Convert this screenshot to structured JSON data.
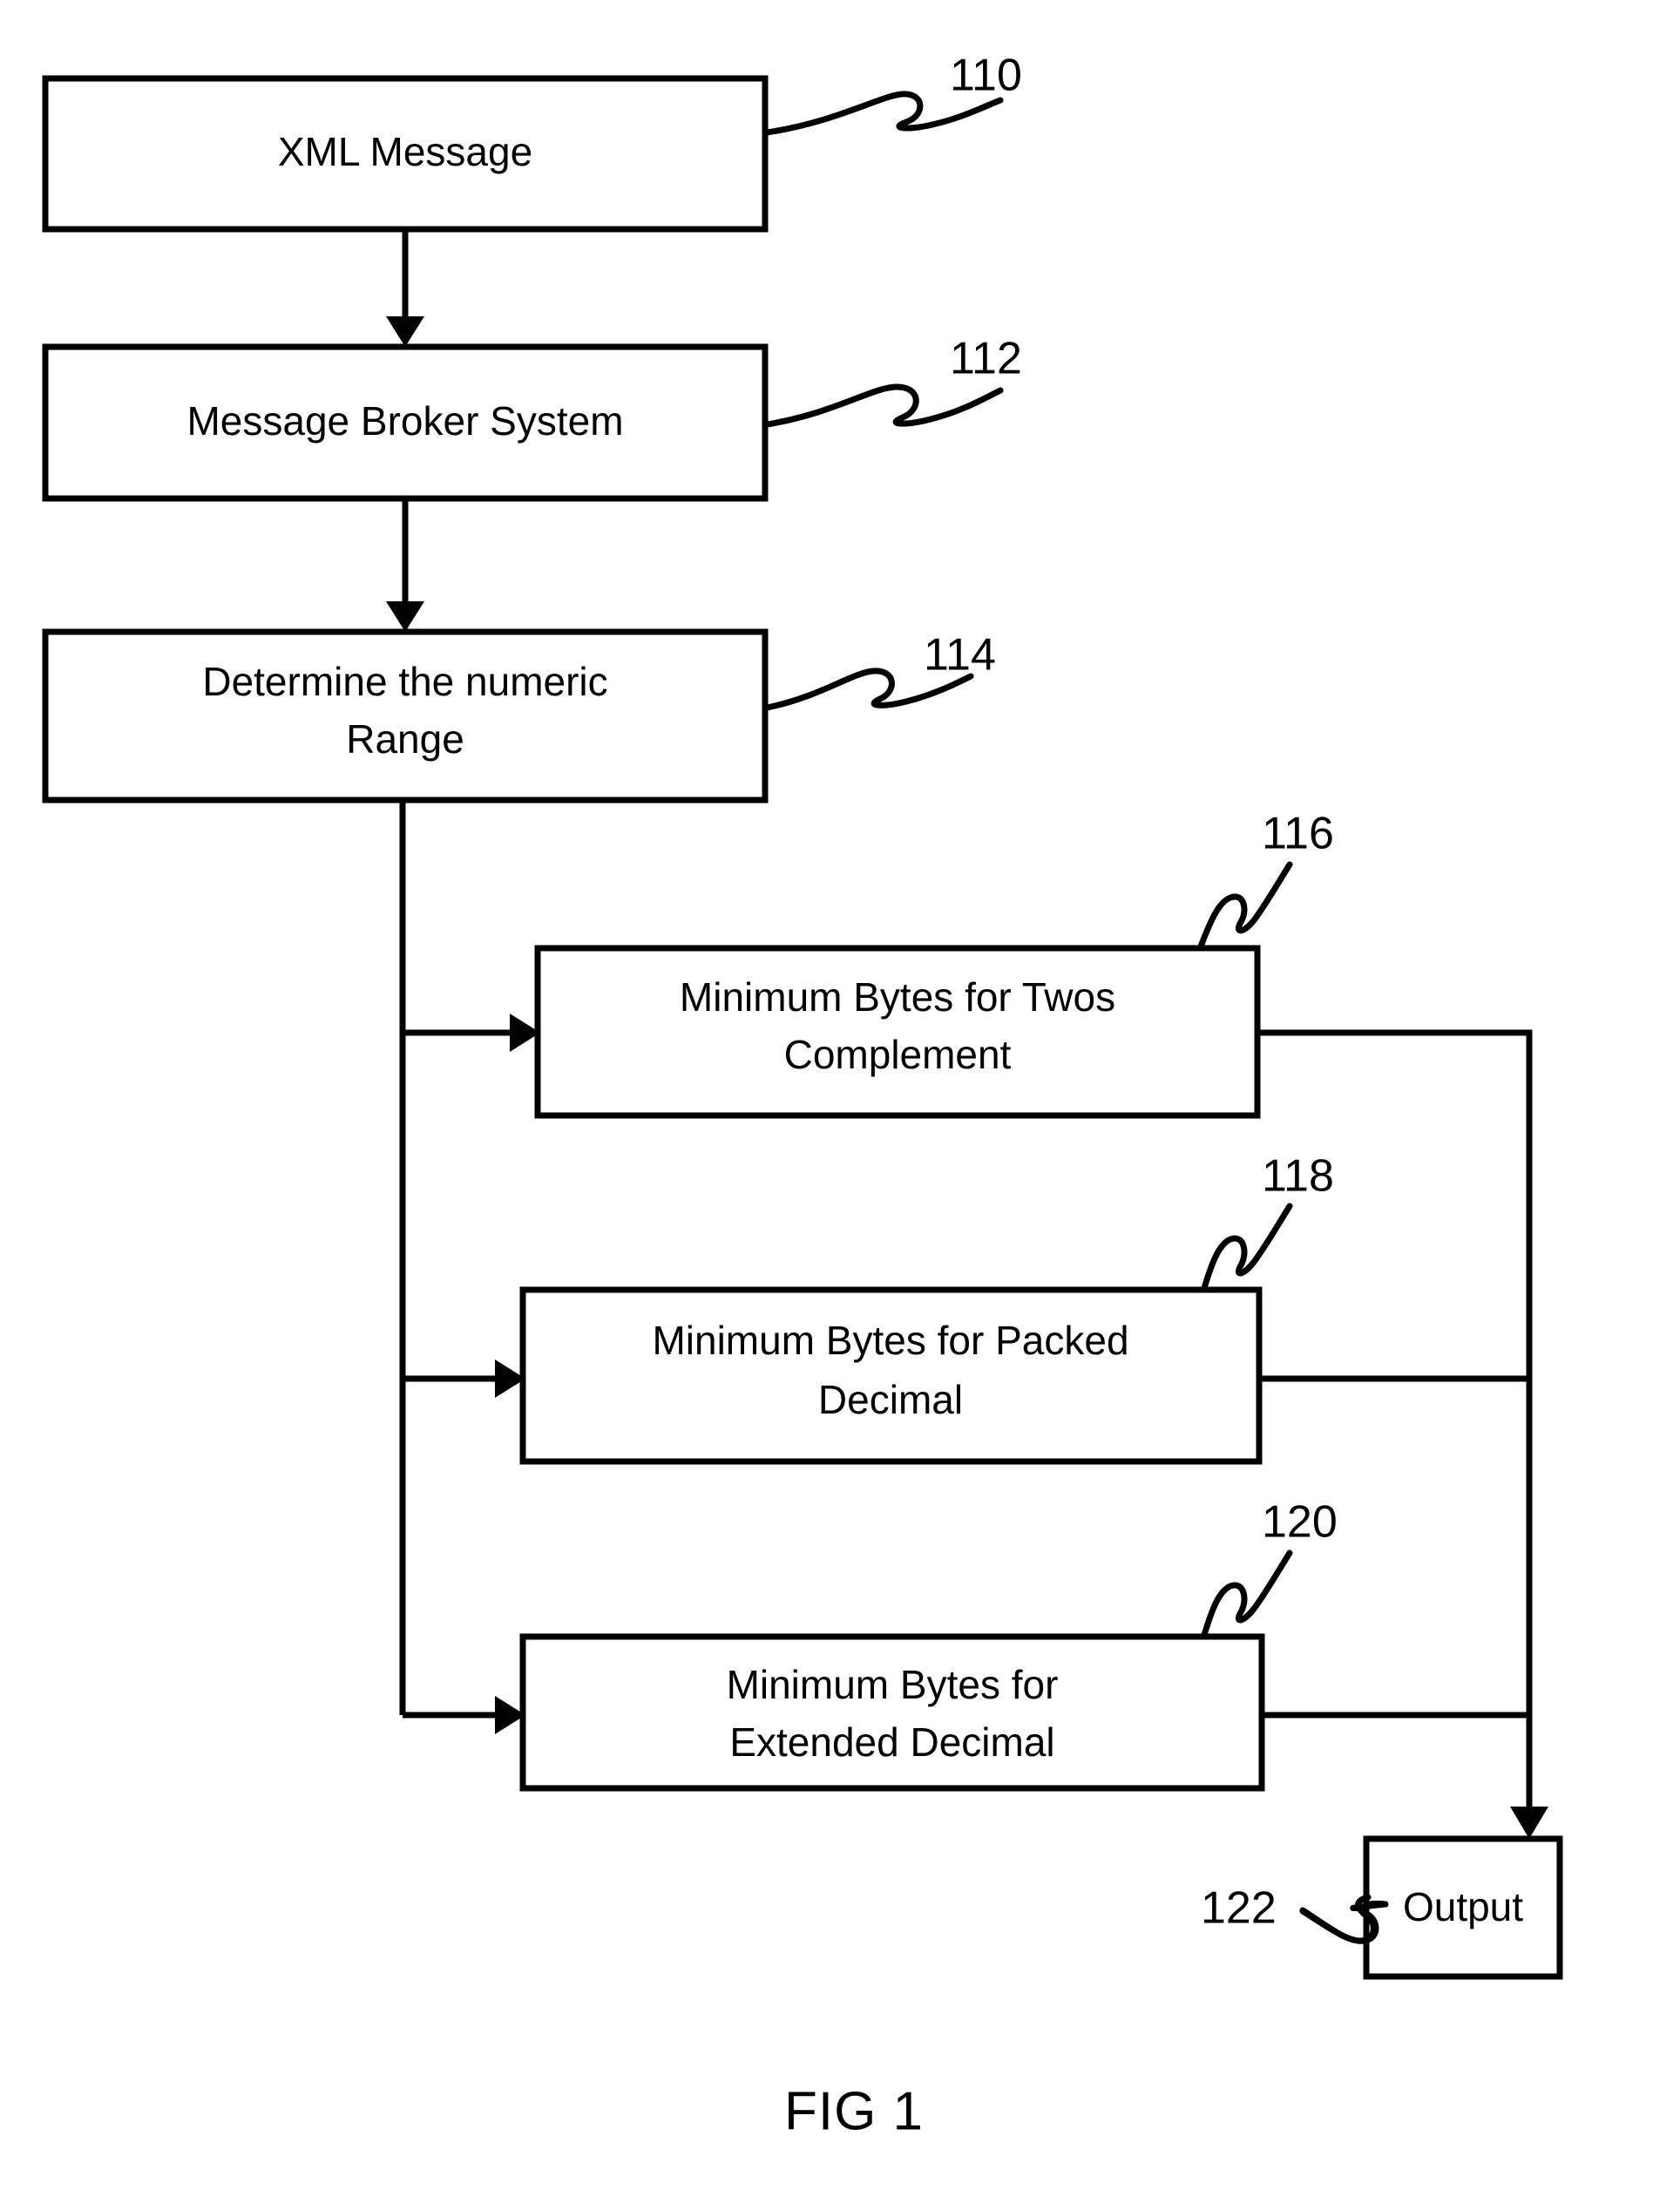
{
  "figure": {
    "caption": "FIG 1",
    "type": "patent-flowchart"
  },
  "nodes": [
    {
      "id": "xml-message",
      "ref": "110",
      "label_line1": "XML Message",
      "label_line2": ""
    },
    {
      "id": "message-broker-system",
      "ref": "112",
      "label_line1": "Message Broker System",
      "label_line2": ""
    },
    {
      "id": "determine-numeric-range",
      "ref": "114",
      "label_line1": "Determine the numeric",
      "label_line2": "Range"
    },
    {
      "id": "min-bytes-twos-complement",
      "ref": "116",
      "label_line1": "Minimum Bytes for Twos",
      "label_line2": "Complement"
    },
    {
      "id": "min-bytes-packed-decimal",
      "ref": "118",
      "label_line1": "Minimum Bytes for Packed",
      "label_line2": "Decimal"
    },
    {
      "id": "min-bytes-extended-decimal",
      "ref": "120",
      "label_line1": "Minimum Bytes for",
      "label_line2": "Extended Decimal"
    },
    {
      "id": "output",
      "ref": "122",
      "label_line1": "Output",
      "label_line2": ""
    }
  ],
  "colors": {
    "stroke": "#000000",
    "fill": "#ffffff",
    "background": "#ffffff"
  }
}
